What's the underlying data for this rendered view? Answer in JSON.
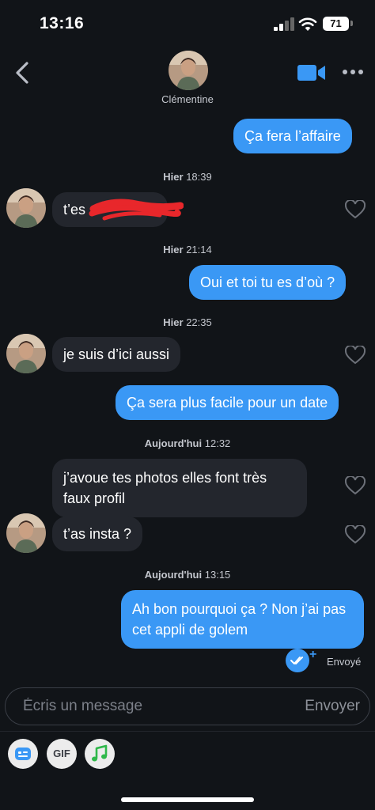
{
  "status_bar": {
    "time": "13:16",
    "battery": "71"
  },
  "header": {
    "contact_name": "Clémentine"
  },
  "messages": [
    {
      "text": "Ça fera l’affaire"
    },
    {
      "timestamp_day": "Hier",
      "timestamp_time": "18:39"
    },
    {
      "text": "t’es"
    },
    {
      "timestamp_day": "Hier",
      "timestamp_time": "21:14"
    },
    {
      "text": "Oui et toi tu es d’où ?"
    },
    {
      "timestamp_day": "Hier",
      "timestamp_time": "22:35"
    },
    {
      "text": "je suis d’ici aussi"
    },
    {
      "text": "Ça sera plus facile pour un date"
    },
    {
      "timestamp_day": "Aujourd'hui",
      "timestamp_time": "12:32"
    },
    {
      "text": "j’avoue tes photos elles font très faux profil"
    },
    {
      "text": "t’as insta ?"
    },
    {
      "timestamp_day": "Aujourd'hui",
      "timestamp_time": "13:15"
    },
    {
      "text": "Ah bon pourquoi ça ? Non j’ai pas cet appli de golem"
    }
  ],
  "delivery_status": "Envoyé",
  "composer": {
    "placeholder": "Écris un message",
    "send_label": "Envoyer"
  },
  "toolbar": {
    "gif_label": "GIF",
    "icons": [
      "sticker-icon",
      "gif-icon",
      "music-note-icon"
    ]
  },
  "colors": {
    "background": "#111418",
    "outgoing_bubble": "#3a98f5",
    "incoming_bubble": "#23262d",
    "redaction": "#e8272b"
  }
}
